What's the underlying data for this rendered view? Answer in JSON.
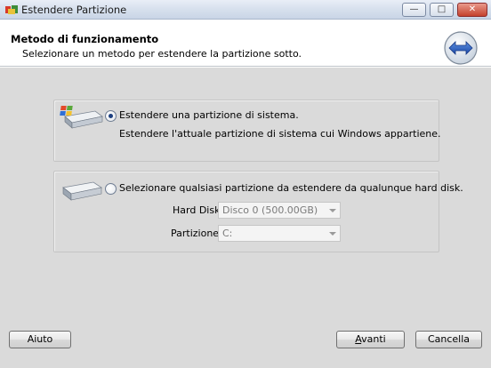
{
  "window": {
    "title": "Estendere Partizione",
    "minimize_glyph": "—",
    "maximize_glyph": "□",
    "close_glyph": "✕"
  },
  "header": {
    "title": "Metodo di funzionamento",
    "subtitle": "Selezionare un metodo per estendere la partizione sotto.",
    "icon": "double-arrow-icon"
  },
  "options": {
    "system_partition": {
      "label": "Estendere una partizione di sistema.",
      "description": "Estendere l'attuale partizione di sistema cui Windows appartiene.",
      "selected": true,
      "icon": "windows-disk-icon"
    },
    "any_partition": {
      "label": "Selezionare qualsiasi partizione da estendere da qualunque hard disk.",
      "selected": false,
      "icon": "disk-icon",
      "hard_disk_label": "Hard Disk",
      "hard_disk_value": "Disco 0 (500.00GB)",
      "partition_label": "Partizione",
      "partition_value": "C:"
    }
  },
  "buttons": {
    "help": "Aiuto",
    "next_prefix": "",
    "next_underlined": "A",
    "next_rest": "vanti",
    "cancel": "Cancella"
  },
  "colors": {
    "body_background": "#dadada",
    "header_background": "#ffffff",
    "accent_blue": "#1c3f80"
  }
}
